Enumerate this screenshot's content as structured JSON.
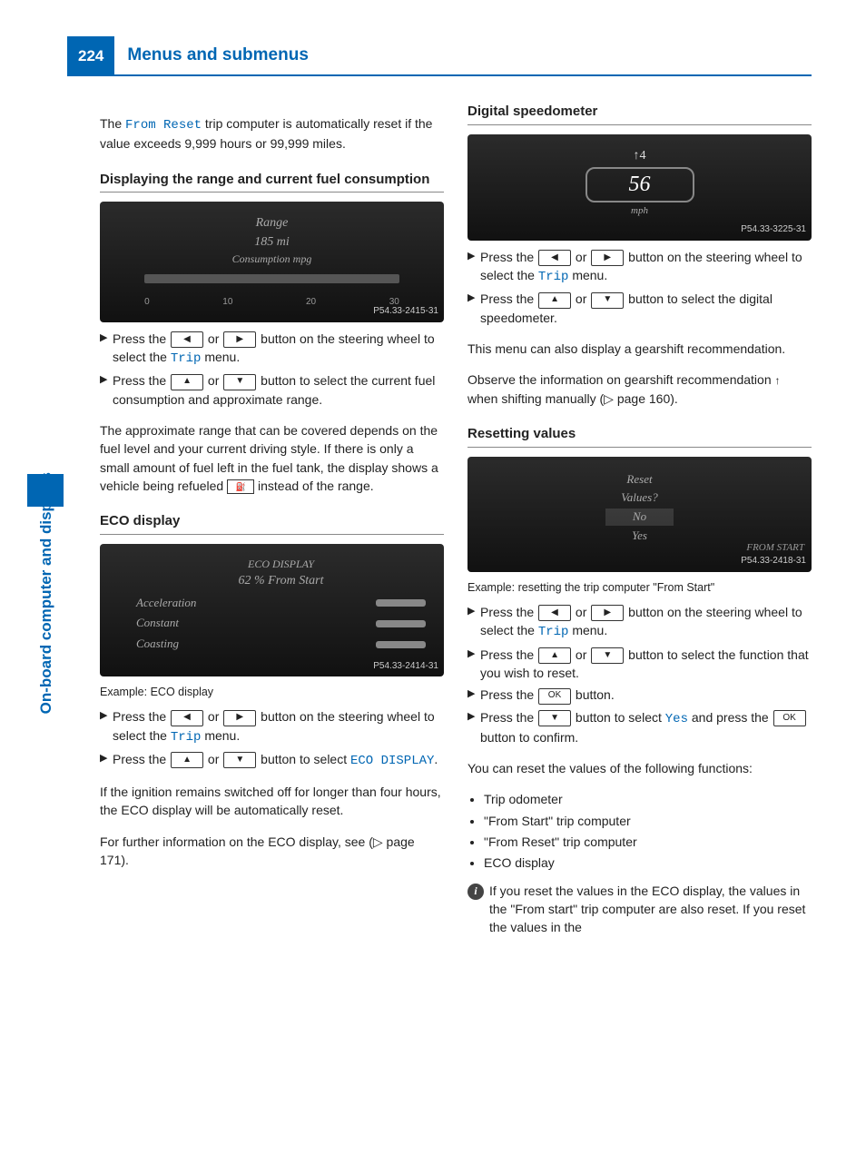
{
  "page_number": "224",
  "header_title": "Menus and submenus",
  "side_label": "On-board computer and displays",
  "col1": {
    "intro_pre": "The ",
    "intro_mono": "From Reset",
    "intro_post": " trip computer is automatically reset if the value exceeds 9,999 hours or 99,999 miles.",
    "sub_range": "Displaying the range and current fuel consumption",
    "range_disp": {
      "title": "Range",
      "value": "185 mi",
      "consumption": "Consumption mpg",
      "ticks": [
        "0",
        "10",
        "20",
        "30"
      ],
      "id": "P54.33-2415-31"
    },
    "step1_a": "Press the ",
    "step1_b": " or ",
    "step1_c": " button on the steering wheel to select the ",
    "step1_trip": "Trip",
    "step1_d": " menu.",
    "step2_a": "Press the ",
    "step2_b": " or ",
    "step2_c": " button to select the current fuel consumption and approximate range.",
    "para_range": "The approximate range that can be covered depends on the fuel level and your current driving style. If there is only a small amount of fuel left in the fuel tank, the display shows a vehicle being refueled ",
    "para_range_post": " instead of the range.",
    "sub_eco": "ECO display",
    "eco_disp": {
      "title": "ECO DISPLAY",
      "percent": "62 % From Start",
      "rows": [
        "Acceleration",
        "Constant",
        "Coasting"
      ],
      "id": "P54.33-2414-31"
    },
    "eco_caption": "Example: ECO display",
    "eco_step1_a": "Press the ",
    "eco_step1_b": " or ",
    "eco_step1_c": " button on the steering wheel to select the ",
    "eco_step1_trip": "Trip",
    "eco_step1_d": " menu.",
    "eco_step2_a": "Press the ",
    "eco_step2_b": " or ",
    "eco_step2_c": " button to select ",
    "eco_step2_mono": "ECO DISPLAY",
    "eco_step2_d": ".",
    "eco_para": "If the ignition remains switched off for longer than four hours, the ECO display will be automatically reset.",
    "eco_ref": "For further information on the ECO display, see (▷ page 171)."
  },
  "col2": {
    "sub_speedo": "Digital speedometer",
    "speedo": {
      "arrow": "↑4",
      "value": "56",
      "unit": "mph",
      "id": "P54.33-3225-31"
    },
    "sp_step1_a": "Press the ",
    "sp_step1_b": " or ",
    "sp_step1_c": " button on the steering wheel to select the ",
    "sp_step1_trip": "Trip",
    "sp_step1_d": " menu.",
    "sp_step2_a": "Press the ",
    "sp_step2_b": " or ",
    "sp_step2_c": " button to select the digital speedometer.",
    "sp_para1": "This menu can also display a gearshift recommendation.",
    "sp_para2_a": "Observe the information on gearshift recommendation ",
    "sp_para2_b": " when shifting manually (▷ page 160).",
    "sub_reset": "Resetting values",
    "reset_disp": {
      "line1": "Reset",
      "line2": "Values?",
      "no": "No",
      "yes": "Yes",
      "from": "FROM START",
      "id": "P54.33-2418-31"
    },
    "reset_caption": "Example: resetting the trip computer \"From Start\"",
    "r_step1_a": "Press the ",
    "r_step1_b": " or ",
    "r_step1_c": " button on the steering wheel to select the ",
    "r_step1_trip": "Trip",
    "r_step1_d": " menu.",
    "r_step2_a": "Press the ",
    "r_step2_b": " or ",
    "r_step2_c": " button to select the function that you wish to reset.",
    "r_step3_a": "Press the ",
    "r_step3_b": " button.",
    "r_step4_a": "Press the ",
    "r_step4_b": " button to select ",
    "r_step4_yes": "Yes",
    "r_step4_c": " and press the ",
    "r_step4_d": " button to confirm.",
    "r_para": "You can reset the values of the following functions:",
    "bullets": [
      "Trip odometer",
      "\"From Start\" trip computer",
      "\"From Reset\" trip computer",
      "ECO display"
    ],
    "note": "If you reset the values in the ECO display, the values in the \"From start\" trip computer are also reset. If you reset the values in the"
  },
  "buttons": {
    "ok": "OK"
  }
}
